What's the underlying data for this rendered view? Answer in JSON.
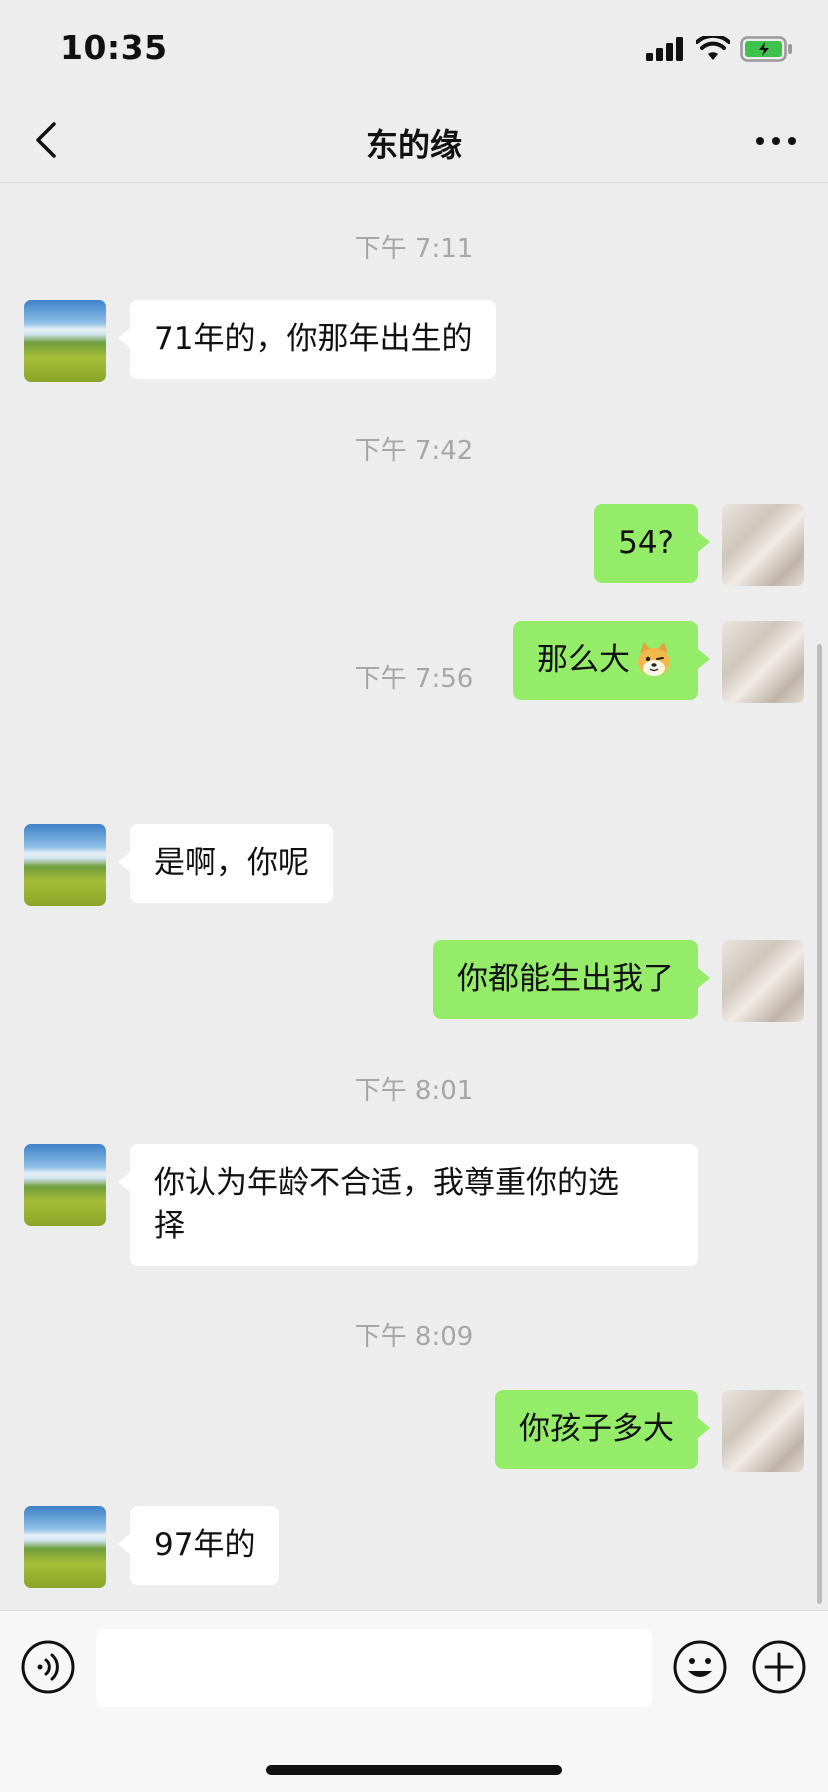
{
  "status_bar": {
    "time": "10:35"
  },
  "header": {
    "title": "东的缘"
  },
  "messages": [
    {
      "timestamp": "下午 7:11"
    },
    {
      "side": "in",
      "text": "71年的，你那年出生的"
    },
    {
      "timestamp": "下午 7:42"
    },
    {
      "side": "out",
      "text": "54?"
    },
    {
      "side": "out",
      "text": "那么大"
    },
    {
      "timestamp": "下午 7:56"
    },
    {
      "side": "in",
      "text": "是啊，你呢"
    },
    {
      "side": "out",
      "text": "你都能生出我了"
    },
    {
      "timestamp": "下午 8:01"
    },
    {
      "side": "in",
      "text_line1": "你认为年龄不合适，我尊重你的选",
      "text_line2": "择"
    },
    {
      "timestamp": "下午 8:09"
    },
    {
      "side": "out",
      "text": "你孩子多大"
    },
    {
      "side": "in",
      "text": "97年的"
    }
  ],
  "input": {
    "placeholder": ""
  },
  "icons": {
    "back": "chevron-left-icon",
    "more": "more-horizontal-icon",
    "voice": "voice-icon",
    "emoji": "emoji-icon",
    "plus": "plus-icon",
    "dog_emoji": "doge-emoji-icon"
  },
  "colors": {
    "background": "#ededed",
    "outgoing_bubble": "#95ec69",
    "incoming_bubble": "#ffffff",
    "timestamp": "#a6a6a6"
  }
}
